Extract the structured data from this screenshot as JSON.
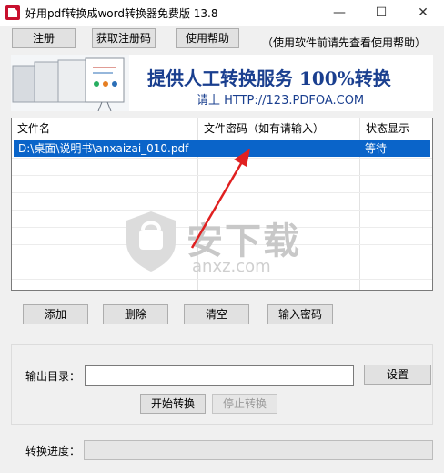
{
  "window": {
    "title": "好用pdf转换成word转换器免费版 13.8",
    "minimize_glyph": "—",
    "maximize_glyph": "☐",
    "close_glyph": "✕"
  },
  "toolbar": {
    "register_label": "注册",
    "get_code_label": "获取注册码",
    "help_label": "使用帮助",
    "note": "（使用软件前请先查看使用帮助）"
  },
  "banner": {
    "headline": "提供人工转换服务 100%转换",
    "subline": "请上  HTTP://123.PDFOA.COM"
  },
  "table": {
    "headers": [
      "文件名",
      "文件密码（如有请输入）",
      "状态显示"
    ],
    "rows": [
      {
        "file": "D:\\桌面\\说明书\\anxaizai_010.pdf",
        "password": "",
        "status": "等待"
      }
    ]
  },
  "watermark": {
    "main": "安下载",
    "sub": "anxz.com"
  },
  "actions": {
    "add_label": "添加",
    "delete_label": "删除",
    "clear_label": "清空",
    "password_label": "输入密码"
  },
  "output": {
    "dir_label": "输出目录：",
    "dir_value": "",
    "settings_label": "设置",
    "start_label": "开始转换",
    "stop_label": "停止转换",
    "progress_label": "转换进度：",
    "progress_percent": 0
  },
  "colors": {
    "selection": "#0a64c9",
    "annotation_arrow": "#e02020",
    "banner_text": "#1a3f8f"
  }
}
